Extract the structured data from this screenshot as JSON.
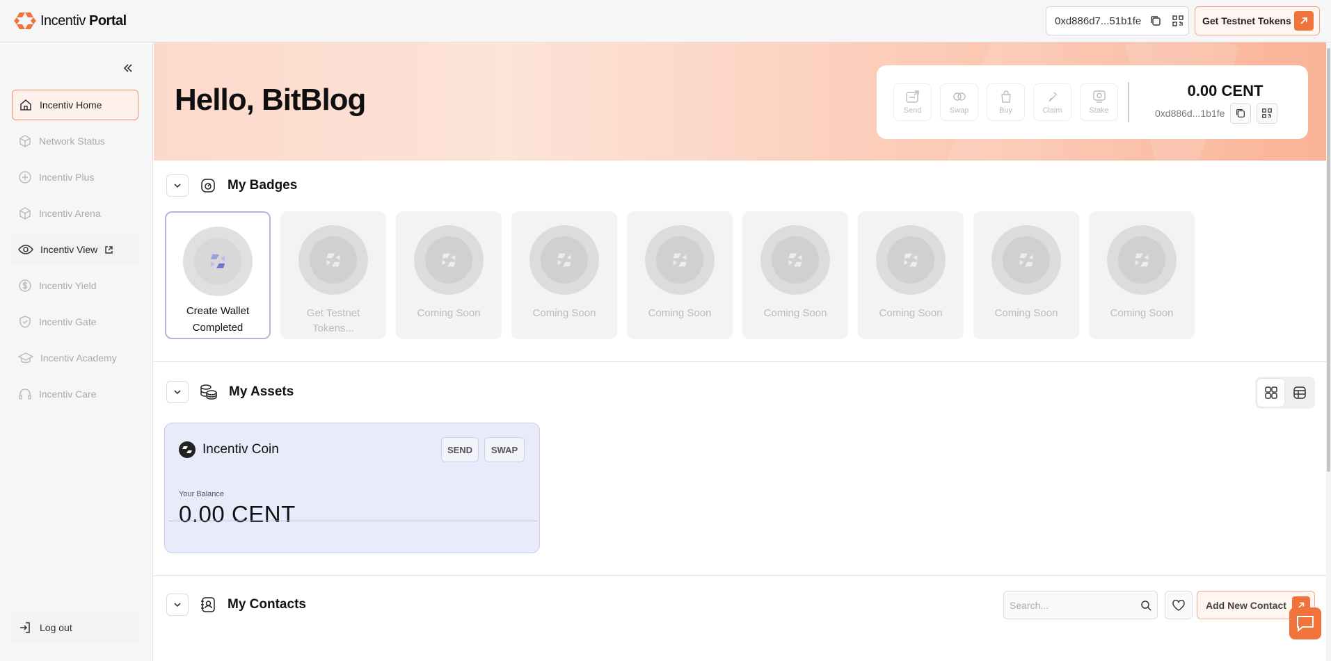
{
  "app": {
    "logo_name": "Incentiv",
    "logo_suffix": "Portal"
  },
  "header": {
    "wallet_address": "0xd886d7...51b1fe",
    "testnet_button": "Get Testnet Tokens"
  },
  "sidebar": {
    "items": [
      {
        "label": "Incentiv Home",
        "icon": "home-icon",
        "active": true
      },
      {
        "label": "Network Status",
        "icon": "cube-icon"
      },
      {
        "label": "Incentiv Plus",
        "icon": "plus-circle-icon"
      },
      {
        "label": "Incentiv Arena",
        "icon": "cube-icon"
      },
      {
        "label": "Incentiv View",
        "icon": "eye-icon",
        "external": true
      },
      {
        "label": "Incentiv Yield",
        "icon": "dollar-icon"
      },
      {
        "label": "Incentiv Gate",
        "icon": "shield-check-icon"
      },
      {
        "label": "Incentiv Academy",
        "icon": "graduation-cap-icon"
      },
      {
        "label": "Incentiv Care",
        "icon": "headset-icon"
      }
    ],
    "logout": "Log out"
  },
  "hero": {
    "greeting": "Hello, BitBlog",
    "actions": [
      "Send",
      "Swap",
      "Buy",
      "Claim",
      "Stake"
    ],
    "balance": "0.00 CENT",
    "address": "0xd886d...1b1fe"
  },
  "badges": {
    "title": "My Badges",
    "items": [
      {
        "label": "Create Wallet Completed",
        "completed": true
      },
      {
        "label": "Get Testnet Tokens..."
      },
      {
        "label": "Coming Soon"
      },
      {
        "label": "Coming Soon"
      },
      {
        "label": "Coming Soon"
      },
      {
        "label": "Coming Soon"
      },
      {
        "label": "Coming Soon"
      },
      {
        "label": "Coming Soon"
      },
      {
        "label": "Coming Soon"
      }
    ]
  },
  "assets": {
    "title": "My Assets",
    "coin": {
      "name": "Incentiv Coin",
      "send": "SEND",
      "swap": "SWAP",
      "balance_label": "Your Balance",
      "balance": "0.00 CENT"
    }
  },
  "contacts": {
    "title": "My Contacts",
    "search_placeholder": "Search...",
    "add_button": "Add New Contact"
  },
  "colors": {
    "accent": "#f0733c",
    "badge_border": "#b3b6dc",
    "coin_card": "#e9eafa"
  }
}
